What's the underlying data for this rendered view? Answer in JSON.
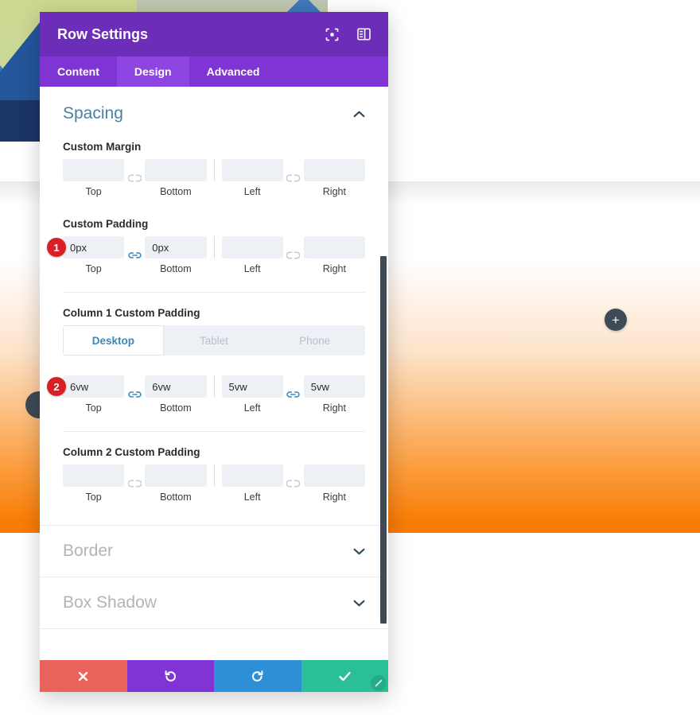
{
  "modal": {
    "title": "Row Settings",
    "header_icons": [
      {
        "name": "focus-target-icon",
        "glyph": "focus"
      },
      {
        "name": "panel-layout-icon",
        "glyph": "panel"
      }
    ],
    "tabs": [
      {
        "label": "Content",
        "active": false
      },
      {
        "label": "Design",
        "active": true
      },
      {
        "label": "Advanced",
        "active": false
      }
    ],
    "sections": {
      "spacing": {
        "title": "Spacing",
        "expanded": true,
        "chevron": "chevron-up",
        "custom_margin": {
          "label": "Custom Margin",
          "badge": null,
          "link_left_pair": "unlinked",
          "link_right_pair": "unlinked",
          "fields": [
            {
              "caption": "Top",
              "value": "",
              "placeholder": ""
            },
            {
              "caption": "Bottom",
              "value": "",
              "placeholder": ""
            },
            {
              "caption": "Left",
              "value": "",
              "placeholder": ""
            },
            {
              "caption": "Right",
              "value": "",
              "placeholder": ""
            }
          ]
        },
        "custom_padding": {
          "label": "Custom Padding",
          "badge": "1",
          "link_left_pair": "linked",
          "link_right_pair": "unlinked",
          "fields": [
            {
              "caption": "Top",
              "value": "0px",
              "placeholder": ""
            },
            {
              "caption": "Bottom",
              "value": "0px",
              "placeholder": ""
            },
            {
              "caption": "Left",
              "value": "",
              "placeholder": ""
            },
            {
              "caption": "Right",
              "value": "",
              "placeholder": ""
            }
          ]
        },
        "column1_padding": {
          "label": "Column 1 Custom Padding",
          "badge": "2",
          "link_left_pair": "linked",
          "link_right_pair": "linked",
          "devices": [
            {
              "label": "Desktop",
              "active": true
            },
            {
              "label": "Tablet",
              "active": false
            },
            {
              "label": "Phone",
              "active": false
            }
          ],
          "fields": [
            {
              "caption": "Top",
              "value": "6vw",
              "placeholder": ""
            },
            {
              "caption": "Bottom",
              "value": "6vw",
              "placeholder": ""
            },
            {
              "caption": "Left",
              "value": "5vw",
              "placeholder": ""
            },
            {
              "caption": "Right",
              "value": "5vw",
              "placeholder": ""
            }
          ]
        },
        "column2_padding": {
          "label": "Column 2 Custom Padding",
          "badge": null,
          "link_left_pair": "unlinked",
          "link_right_pair": "unlinked",
          "fields": [
            {
              "caption": "Top",
              "value": "",
              "placeholder": ""
            },
            {
              "caption": "Bottom",
              "value": "",
              "placeholder": ""
            },
            {
              "caption": "Left",
              "value": "",
              "placeholder": ""
            },
            {
              "caption": "Right",
              "value": "",
              "placeholder": ""
            }
          ]
        }
      },
      "border": {
        "title": "Border",
        "expanded": false,
        "chevron": "chevron-down"
      },
      "box_shadow": {
        "title": "Box Shadow",
        "expanded": false,
        "chevron": "chevron-down"
      }
    },
    "footer": [
      {
        "name": "cancel-button",
        "icon": "close-x-icon",
        "glyph": "✖",
        "color": "#e8635b"
      },
      {
        "name": "undo-button",
        "icon": "undo-arrow-icon",
        "glyph": "↺",
        "color": "#8134d6"
      },
      {
        "name": "redo-button",
        "icon": "redo-arrow-icon",
        "glyph": "↻",
        "color": "#2d8fd5"
      },
      {
        "name": "save-button",
        "icon": "checkmark-icon",
        "glyph": "✔",
        "color": "#2bbf98"
      }
    ]
  },
  "canvas": {
    "add_button_glyph": "+",
    "accent_orange": "#f97c06",
    "rail_color": "#3e4a56"
  },
  "colors": {
    "header_purple": "#6c2eb9",
    "tab_purple": "#7f35d4",
    "tab_active_purple": "#8c45e0",
    "section_title_blue": "#4b7fa0",
    "input_bg": "#edf1f5",
    "badge_red": "#d81f26",
    "link_active_blue": "#3c8dc4"
  }
}
